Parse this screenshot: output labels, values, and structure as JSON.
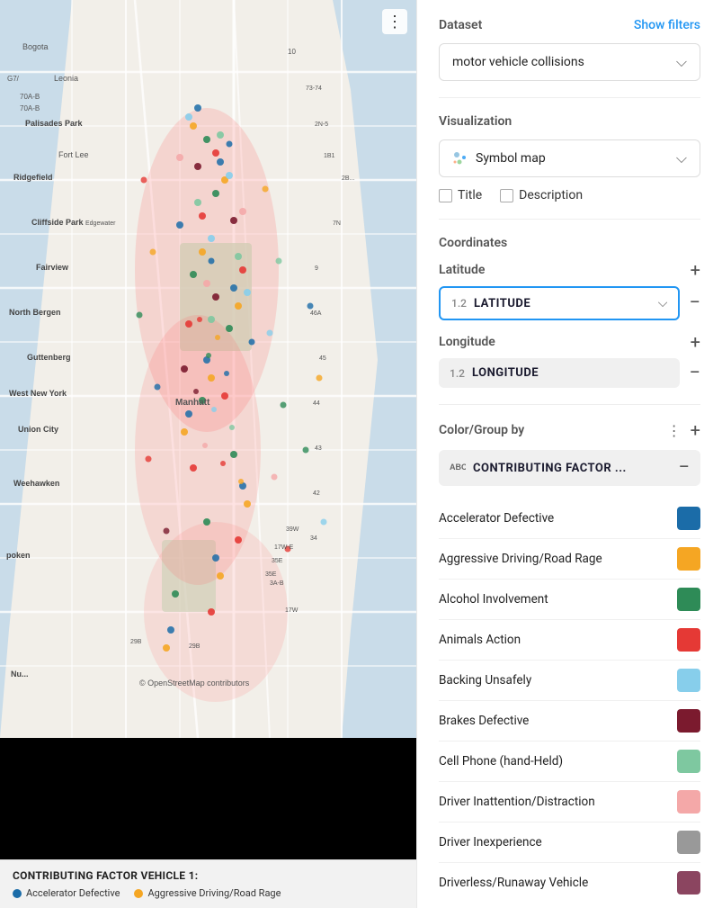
{
  "map": {
    "legend_title": "CONTRIBUTING FACTOR VEHICLE 1:",
    "legend_items": [
      {
        "label": "Accelerator Defective",
        "color": "#1b6ca8"
      },
      {
        "label": "Aggressive Driving/Road Rage",
        "color": "#f5a623"
      }
    ]
  },
  "dataset": {
    "label": "Dataset",
    "show_filters": "Show filters",
    "value": "motor vehicle collisions",
    "placeholder": "motor vehicle collisions"
  },
  "visualization": {
    "label": "Visualization",
    "value": "Symbol map",
    "title_label": "Title",
    "description_label": "Description"
  },
  "coordinates": {
    "label": "Coordinates",
    "latitude": {
      "label": "Latitude",
      "field_num": "1.2",
      "field_text": "LATITUDE"
    },
    "longitude": {
      "label": "Longitude",
      "field_num": "1.2",
      "field_text": "LONGITUDE"
    }
  },
  "color_group": {
    "label": "Color/Group by",
    "field_text": "CONTRIBUTING FACTOR ...",
    "abc_label": "ABC"
  },
  "legend_list": [
    {
      "name": "Accelerator Defective",
      "color": "#1b6ca8"
    },
    {
      "name": "Aggressive Driving/Road Rage",
      "color": "#f5a623"
    },
    {
      "name": "Alcohol Involvement",
      "color": "#2e8b57"
    },
    {
      "name": "Animals Action",
      "color": "#e53935"
    },
    {
      "name": "Backing Unsafely",
      "color": "#87ceeb"
    },
    {
      "name": "Brakes Defective",
      "color": "#7b1a2e"
    },
    {
      "name": "Cell Phone (hand-Held)",
      "color": "#7ec8a0"
    },
    {
      "name": "Driver Inattention/Distraction",
      "color": "#f4a8a8"
    },
    {
      "name": "Driver Inexperience",
      "color": "#999999"
    },
    {
      "name": "Driverless/Runaway Vehicle",
      "color": "#8b4560"
    }
  ],
  "icons": {
    "more_dots": "⋮",
    "dropdown_arrow": "⌄",
    "plus": "+",
    "minus": "−"
  }
}
